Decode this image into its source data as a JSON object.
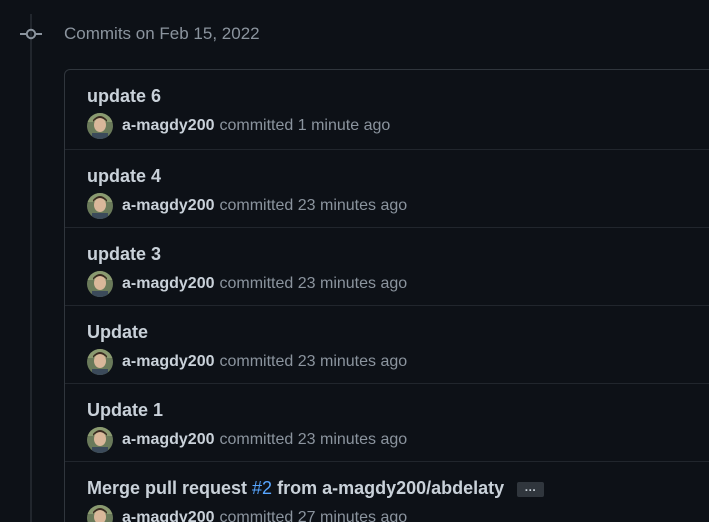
{
  "group": {
    "header": "Commits on Feb 15, 2022"
  },
  "commits": [
    {
      "title": "update 6",
      "author": "a-magdy200",
      "action": "committed",
      "time": "1 minute ago"
    },
    {
      "title": "update 4",
      "author": "a-magdy200",
      "action": "committed",
      "time": "23 minutes ago"
    },
    {
      "title": "update 3",
      "author": "a-magdy200",
      "action": "committed",
      "time": "23 minutes ago"
    },
    {
      "title": "Update",
      "author": "a-magdy200",
      "action": "committed",
      "time": "23 minutes ago"
    },
    {
      "title": "Update 1",
      "author": "a-magdy200",
      "action": "committed",
      "time": "23 minutes ago"
    },
    {
      "title_prefix": "Merge pull request",
      "pr_link": "#2",
      "title_suffix": "from a-magdy200/abdelaty",
      "ellipsis": "…",
      "author": "a-magdy200",
      "action": "committed",
      "time": "27 minutes ago"
    }
  ],
  "colors": {
    "background": "#0d1117",
    "border": "#30363d",
    "text_primary": "#c9d1d9",
    "text_muted": "#8b949e",
    "link": "#58a6ff"
  },
  "icons": {
    "timeline": "git-commit-icon",
    "avatar": "user-avatar"
  }
}
